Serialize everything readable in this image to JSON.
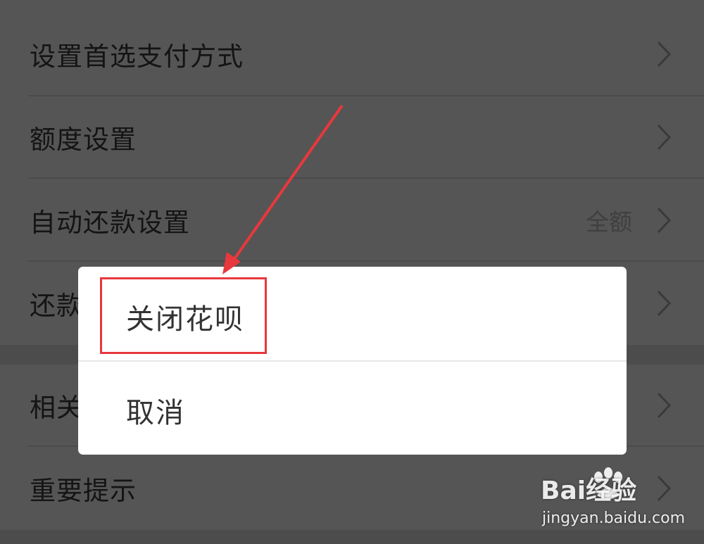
{
  "settings": {
    "items": [
      {
        "label": "设置首选支付方式",
        "value": ""
      },
      {
        "label": "额度设置",
        "value": ""
      },
      {
        "label": "自动还款设置",
        "value": "全额"
      },
      {
        "label": "还款",
        "value": ""
      },
      {
        "label": "相关",
        "value": ""
      },
      {
        "label": "重要提示",
        "value": ""
      }
    ]
  },
  "dialog": {
    "close_option": "关闭花呗",
    "cancel_option": "取消"
  },
  "annotation": {
    "highlight_color": "#e8383d"
  },
  "watermark": {
    "brand": "Bai经验",
    "url": "jingyan.baidu.com"
  },
  "colors": {
    "overlay_background": "#555555",
    "dialog_background": "#ffffff"
  }
}
